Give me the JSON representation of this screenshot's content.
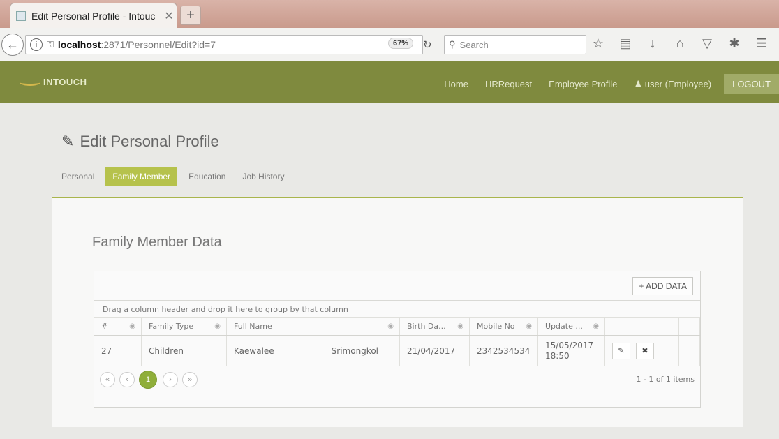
{
  "browser": {
    "tab_title": "Edit Personal Profile - Intouc",
    "tab_close": "✕",
    "new_tab": "+",
    "url_host": "localhost",
    "url_path": ":2871/Personnel/Edit?id=7",
    "zoom": "67%",
    "search_placeholder": "Search"
  },
  "app": {
    "brand": "INTOUCH",
    "nav": {
      "home": "Home",
      "hr_request": "HRRequest",
      "employee_profile": "Employee Profile",
      "user": "user (Employee)",
      "logout": "LOGOUT"
    }
  },
  "page": {
    "title": "Edit Personal Profile",
    "tabs": [
      "Personal",
      "Family Member",
      "Education",
      "Job History"
    ],
    "active_tab": "Family Member"
  },
  "section": {
    "title": "Family Member Data",
    "add_button": "+ ADD DATA",
    "group_hint": "Drag a column header and drop it here to group by that column"
  },
  "grid": {
    "columns": [
      "#",
      "Family Type",
      "Full Name",
      "Birth Da...",
      "Mobile No",
      "Update ..."
    ],
    "rows": [
      {
        "id": "27",
        "family_type": "Children",
        "first_name": "Kaewalee",
        "last_name": "Srimongkol",
        "birth_date": "21/04/2017",
        "mobile": "2342534534",
        "update_date": "15/05/2017",
        "update_time": "18:50"
      }
    ],
    "pager": {
      "current_page": "1",
      "info": "1 - 1 of 1 items"
    }
  },
  "colors": {
    "header_bg": "#7f8a3e",
    "accent": "#b6c24c",
    "page_active": "#8fae3a"
  }
}
